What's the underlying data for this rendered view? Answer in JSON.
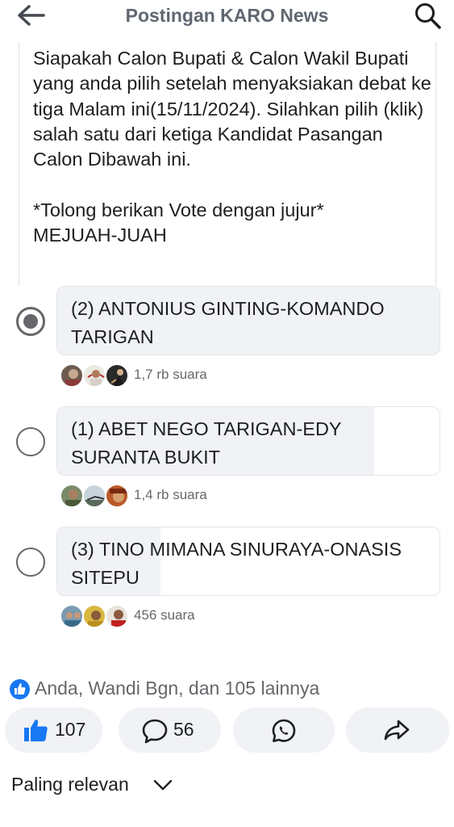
{
  "header": {
    "back_icon": "arrow-left-icon",
    "title": "Postingan KARO News",
    "search_icon": "search-icon"
  },
  "post": {
    "text": "Siapakah Calon Bupati & Calon Wakil Bupati yang anda pilih setelah menyaksiakan debat ke tiga Malam ini(15/11/2024). Silahkan pilih (klik) salah satu dari ketiga Kandidat Pasangan Calon Dibawah ini.\n\n*Tolong berikan Vote dengan jujur*\nMEJUAH-JUAH"
  },
  "poll": {
    "options": [
      {
        "label": "(2) ANTONIUS GINTING-KOMANDO TARIGAN",
        "votes": "1,7 rb suara",
        "selected": true,
        "fill_fraction": 1.0
      },
      {
        "label": "(1) ABET NEGO TARIGAN-EDY SURANTA BUKIT",
        "votes": "1,4 rb suara",
        "selected": false,
        "fill_fraction": 0.83
      },
      {
        "label": "(3) TINO MIMANA SINURAYA-ONASIS SITEPU",
        "votes": "456 suara",
        "selected": false,
        "fill_fraction": 0.27
      }
    ]
  },
  "reactions": {
    "icon": "like-icon",
    "summary": "Anda, Wandi Bgn, dan 105 lainnya"
  },
  "actions": {
    "like_count": "107",
    "comment_count": "56",
    "whatsapp_icon": "whatsapp-icon",
    "share_icon": "share-icon"
  },
  "sort": {
    "label": "Paling relevan",
    "icon": "chevron-down-icon"
  },
  "colors": {
    "accent": "#1877f2",
    "fill": "#f0f2f5",
    "secondary_text": "#65676b"
  }
}
